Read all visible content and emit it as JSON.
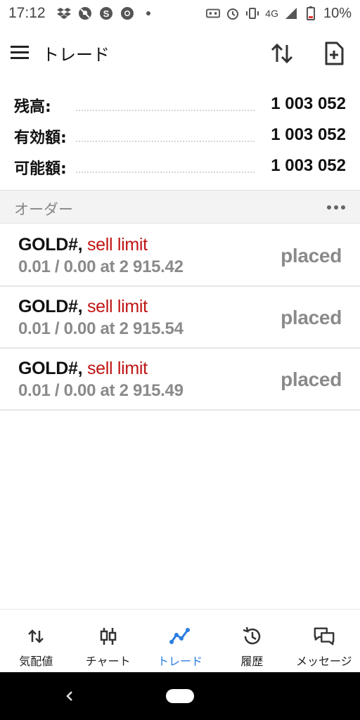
{
  "status_bar": {
    "time": "17:12",
    "network": "4G",
    "battery": "10%",
    "icons": [
      "dropbox-icon",
      "notifications-off-icon",
      "s-app-icon",
      "chrome-icon",
      "dot-icon",
      "voicemail-icon",
      "alarm-icon",
      "vibrate-icon",
      "signal-icon",
      "battery-low-icon"
    ],
    "battery_color": "#e53935"
  },
  "app_bar": {
    "title": "トレード",
    "icons": [
      "menu-icon",
      "sort-icon",
      "new-order-icon"
    ]
  },
  "balance": {
    "rows": [
      {
        "label": "残高:",
        "value": "1 003 052"
      },
      {
        "label": "有効額:",
        "value": "1 003 052"
      },
      {
        "label": "可能額:",
        "value": "1 003 052"
      }
    ]
  },
  "orders": {
    "title": "オーダー",
    "items": [
      {
        "symbol": "GOLD#,",
        "type": "sell limit",
        "details": "0.01 / 0.00 at 2 915.42",
        "status": "placed"
      },
      {
        "symbol": "GOLD#,",
        "type": "sell limit",
        "details": "0.01 / 0.00 at 2 915.54",
        "status": "placed"
      },
      {
        "symbol": "GOLD#,",
        "type": "sell limit",
        "details": "0.01 / 0.00 at 2 915.49",
        "status": "placed"
      }
    ]
  },
  "bottom_nav": {
    "items": [
      {
        "label": "気配値",
        "icon": "quotes-icon",
        "active": false
      },
      {
        "label": "チャート",
        "icon": "chart-icon",
        "active": false
      },
      {
        "label": "トレード",
        "icon": "trade-icon",
        "active": true
      },
      {
        "label": "履歴",
        "icon": "history-icon",
        "active": false
      },
      {
        "label": "メッセージ",
        "icon": "messages-icon",
        "active": false
      }
    ]
  },
  "colors": {
    "accent": "#2a7de1",
    "sell": "#c01414",
    "muted": "#8a8a8a"
  }
}
